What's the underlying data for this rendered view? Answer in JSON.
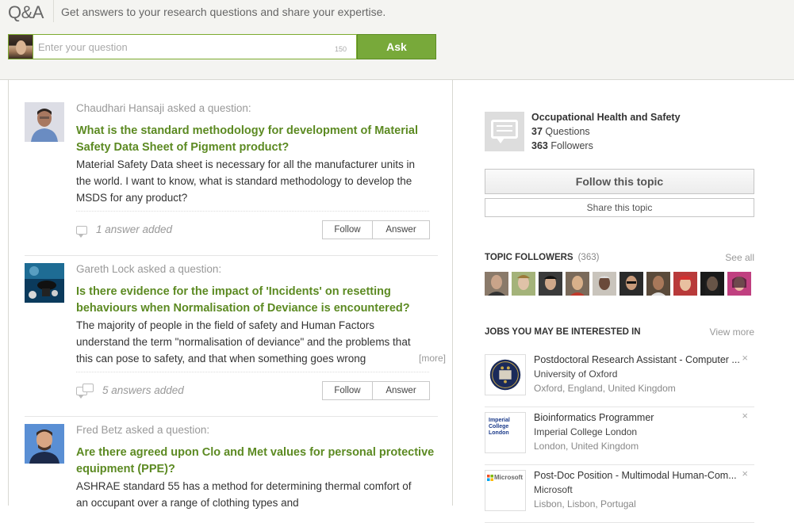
{
  "header": {
    "logo": "Q&A",
    "tagline": "Get answers to your research questions and share your expertise.",
    "ask_placeholder": "Enter your question",
    "char_counter": "150",
    "ask_label": "Ask"
  },
  "questions": [
    {
      "asker": "Chaudhari Hansaji asked a question:",
      "title": "What is the standard methodology for development of Material Safety Data Sheet of Pigment product?",
      "text": "Material Safety Data sheet is necessary for all the manufacturer units in the world. I want to know, what is standard methodology to develop the MSDS for any product?",
      "answers": "1 answer added",
      "follow_label": "Follow",
      "answer_label": "Answer"
    },
    {
      "asker": "Gareth Lock asked a question:",
      "title": "Is there evidence for the impact of 'Incidents' on resetting behaviours when Normalisation of Deviance is encountered?",
      "text": "The majority of people in the field of safety and Human Factors understand the term \"normalisation of deviance\" and the problems that this can pose to safety, and that when something goes wrong",
      "more": "[more]",
      "answers": "5 answers added",
      "follow_label": "Follow",
      "answer_label": "Answer"
    },
    {
      "asker": "Fred Betz asked a question:",
      "title": "Are there agreed upon Clo and Met values for personal protective equipment (PPE)?",
      "text": "ASHRAE standard 55 has a method for determining thermal comfort of an occupant over a range of clothing types and"
    }
  ],
  "topic": {
    "name": "Occupational Health and Safety",
    "questions_count": "37",
    "questions_label": "Questions",
    "followers_count": "363",
    "followers_label": "Followers",
    "follow_label": "Follow this topic",
    "share_label": "Share this topic"
  },
  "topic_followers": {
    "title": "TOPIC FOLLOWERS",
    "count": "(363)",
    "see_all": "See all"
  },
  "jobs": {
    "title": "JOBS YOU MAY BE INTERESTED IN",
    "view_more": "View more",
    "items": [
      {
        "title": "Postdoctoral Research Assistant - Computer ...",
        "org": "University of Oxford",
        "location": "Oxford, England, United Kingdom"
      },
      {
        "title": "Bioinformatics Programmer",
        "org": "Imperial College London",
        "location": "London, United Kingdom",
        "logo_text": "Imperial College London"
      },
      {
        "title": "Post-Doc Position - Multimodal Human-Com...",
        "org": "Microsoft",
        "location": "Lisbon, Lisbon, Portugal",
        "logo_text": "Microsoft"
      }
    ],
    "close_glyph": "×"
  },
  "colors": {
    "accent_green": "#78a93a",
    "title_green": "#5c8a22"
  }
}
